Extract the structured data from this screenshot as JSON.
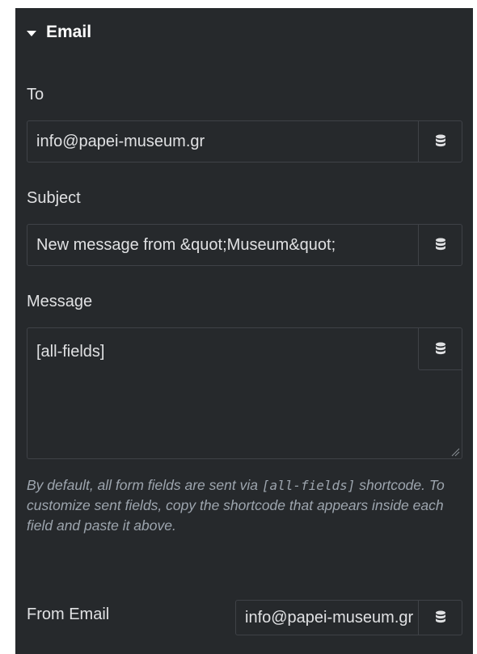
{
  "section": {
    "title": "Email",
    "caret_icon": "caret-down-icon"
  },
  "to": {
    "label": "To",
    "value": "info@papei-museum.gr"
  },
  "subject": {
    "label": "Subject",
    "value": "New message from &quot;Museum&quot;"
  },
  "message": {
    "label": "Message",
    "value": "[all-fields]"
  },
  "help": {
    "prefix": "By default, all form fields are sent via ",
    "shortcode": "[all-fields]",
    "suffix": " shortcode. To customize sent fields, copy the shortcode that appears inside each field and paste it above."
  },
  "from_email": {
    "label": "From Email",
    "value": "info@papei-museum.gr"
  },
  "dynamic_tags_icon": "database-icon",
  "colors": {
    "panel_bg": "#26292c",
    "border": "#3f4247",
    "text": "#e0e1e3",
    "help_text": "#9da5ae"
  }
}
